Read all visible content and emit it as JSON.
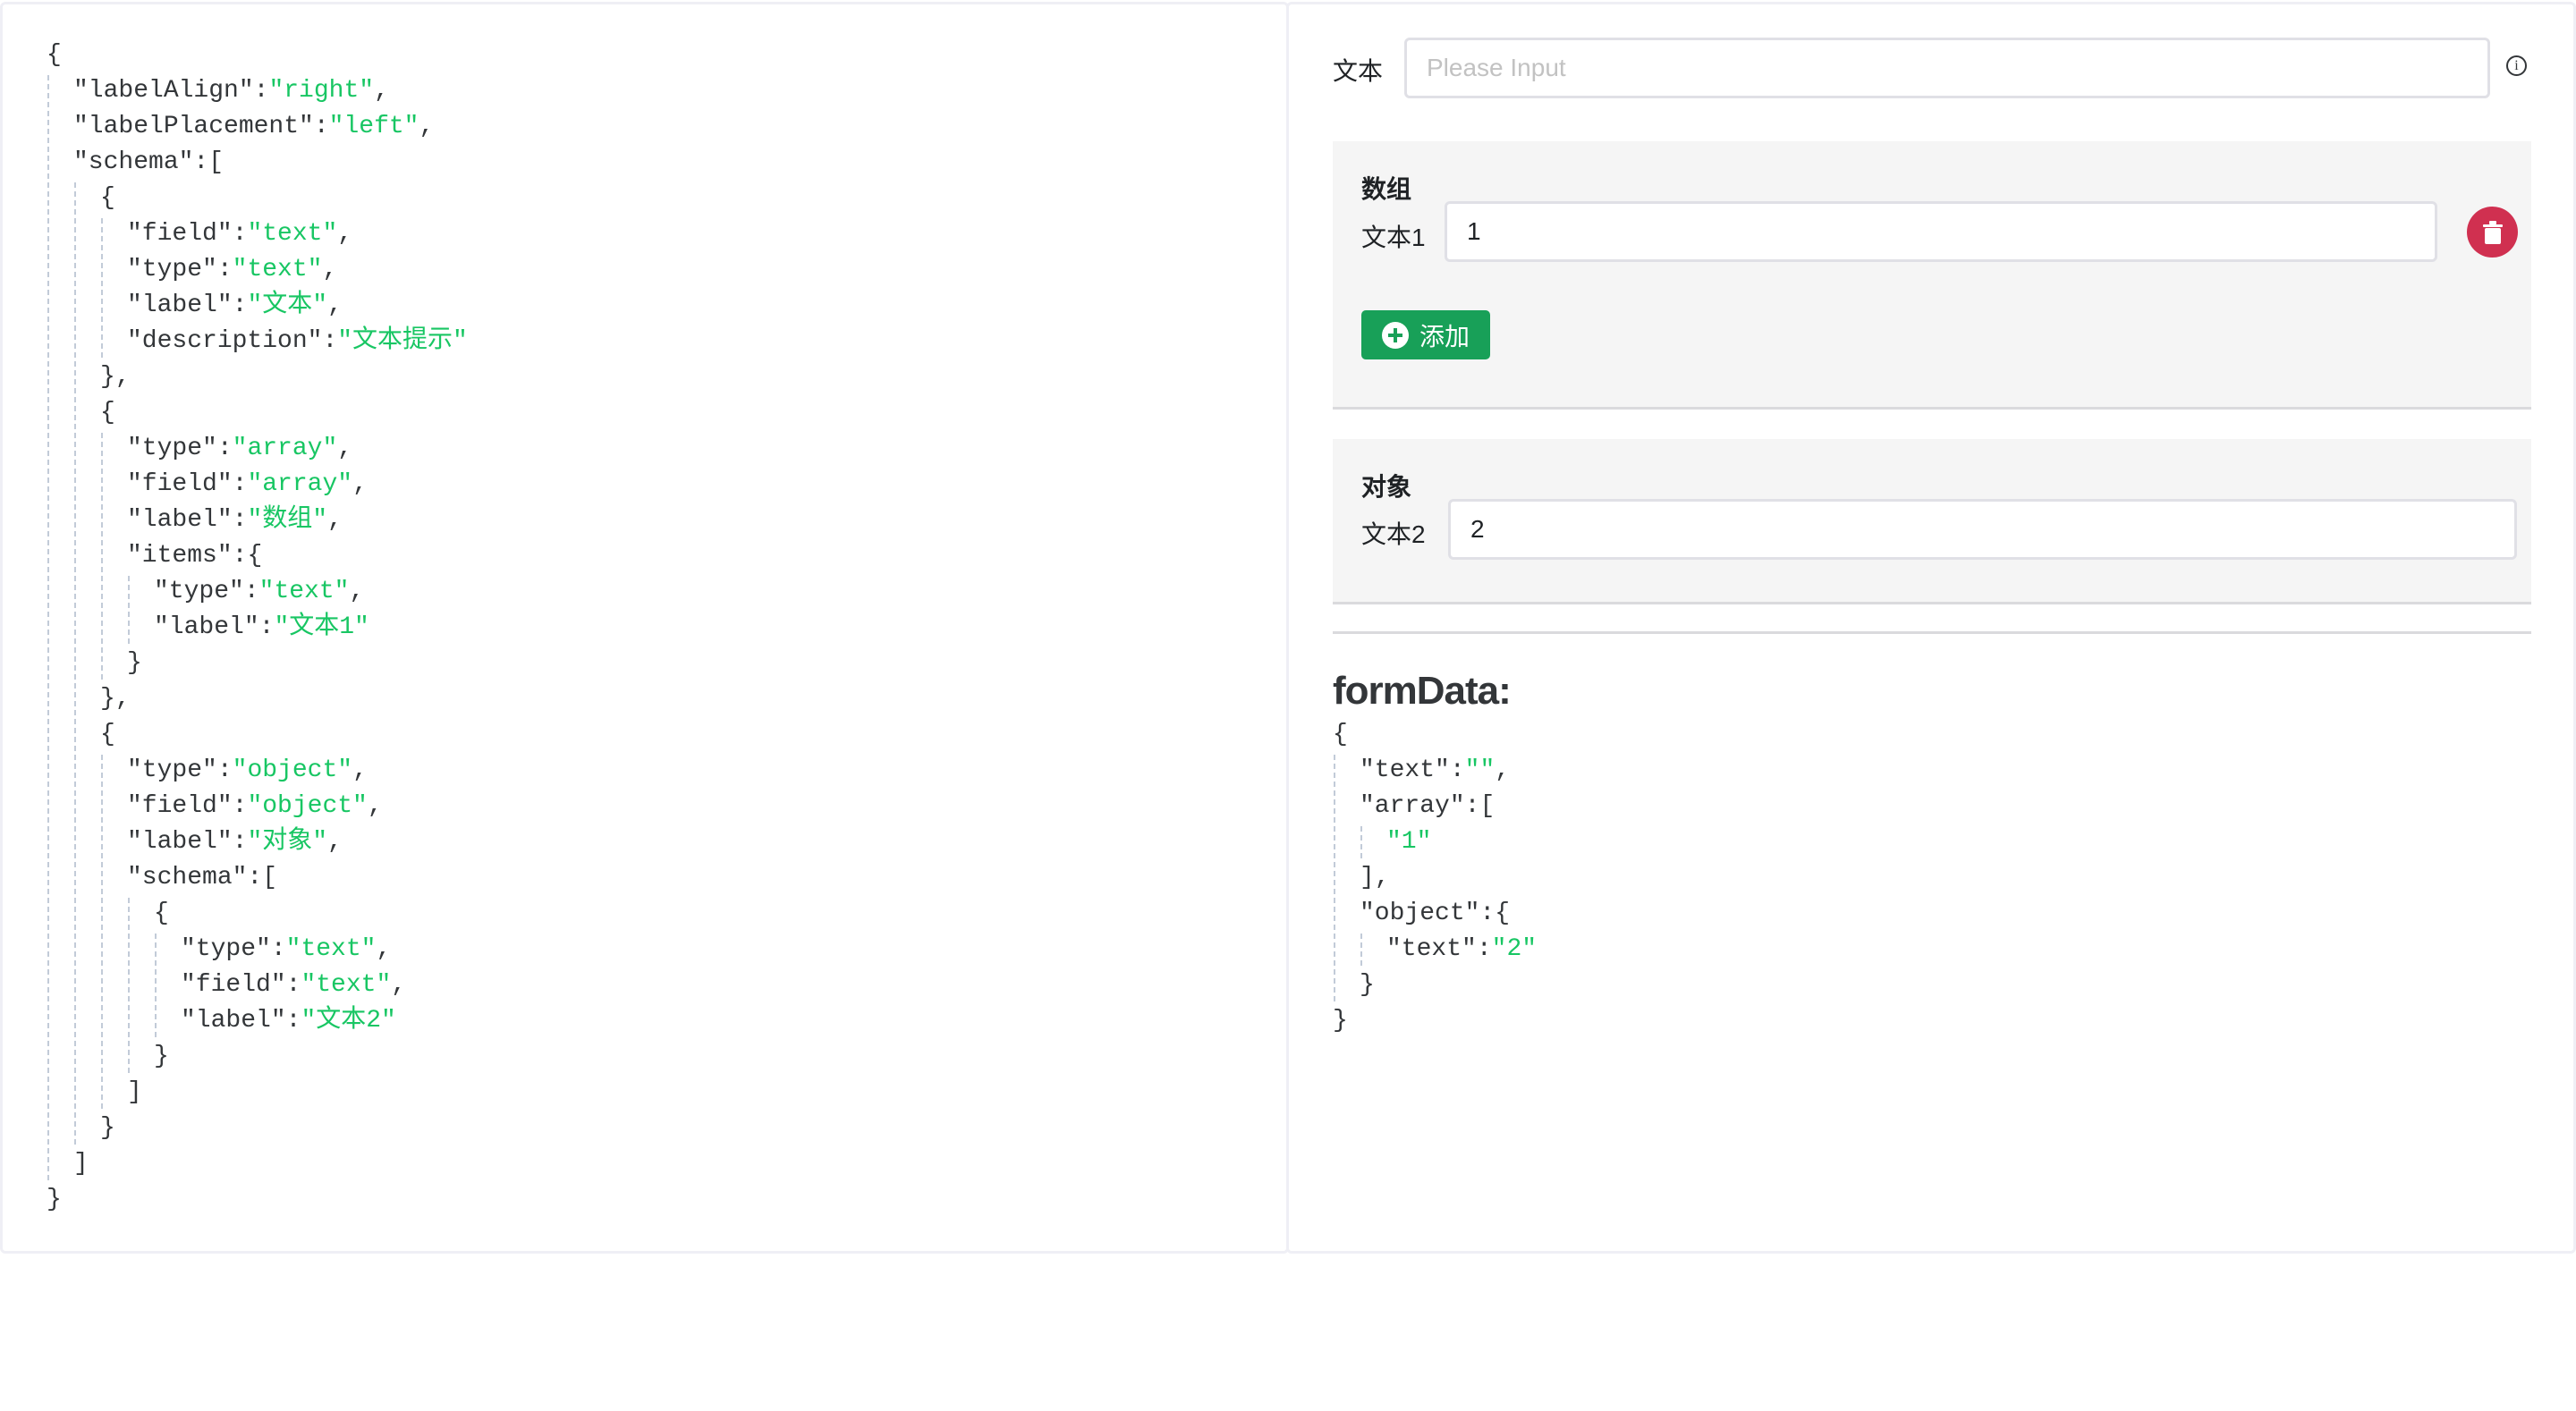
{
  "schema_editor": {
    "code": {
      "labelAlign": "right",
      "labelPlacement": "left",
      "schema": [
        {
          "field": "text",
          "type": "text",
          "label": "文本",
          "description": "文本提示"
        },
        {
          "type": "array",
          "field": "array",
          "label": "数组",
          "items": {
            "type": "text",
            "label": "文本1"
          }
        },
        {
          "type": "object",
          "field": "object",
          "label": "对象",
          "schema": [
            {
              "type": "text",
              "field": "text",
              "label": "文本2"
            }
          ]
        }
      ]
    }
  },
  "form": {
    "text_field": {
      "label": "文本",
      "value": "",
      "placeholder": "Please Input",
      "info_icon": "info-circle-icon"
    },
    "array_group": {
      "title": "数组",
      "items": [
        {
          "label": "文本1",
          "value": "1"
        }
      ],
      "delete_icon": "trash-icon",
      "add_button": {
        "label": "添加",
        "icon": "plus-circle-icon"
      }
    },
    "object_group": {
      "title": "对象",
      "fields": [
        {
          "label": "文本2",
          "value": "2"
        }
      ]
    }
  },
  "output": {
    "heading": "formData:",
    "formData": {
      "text": "",
      "array": [
        "1"
      ],
      "object": {
        "text": "2"
      }
    }
  },
  "colors": {
    "primary": "#18a058",
    "danger": "#d03050",
    "string": "#18c663"
  }
}
